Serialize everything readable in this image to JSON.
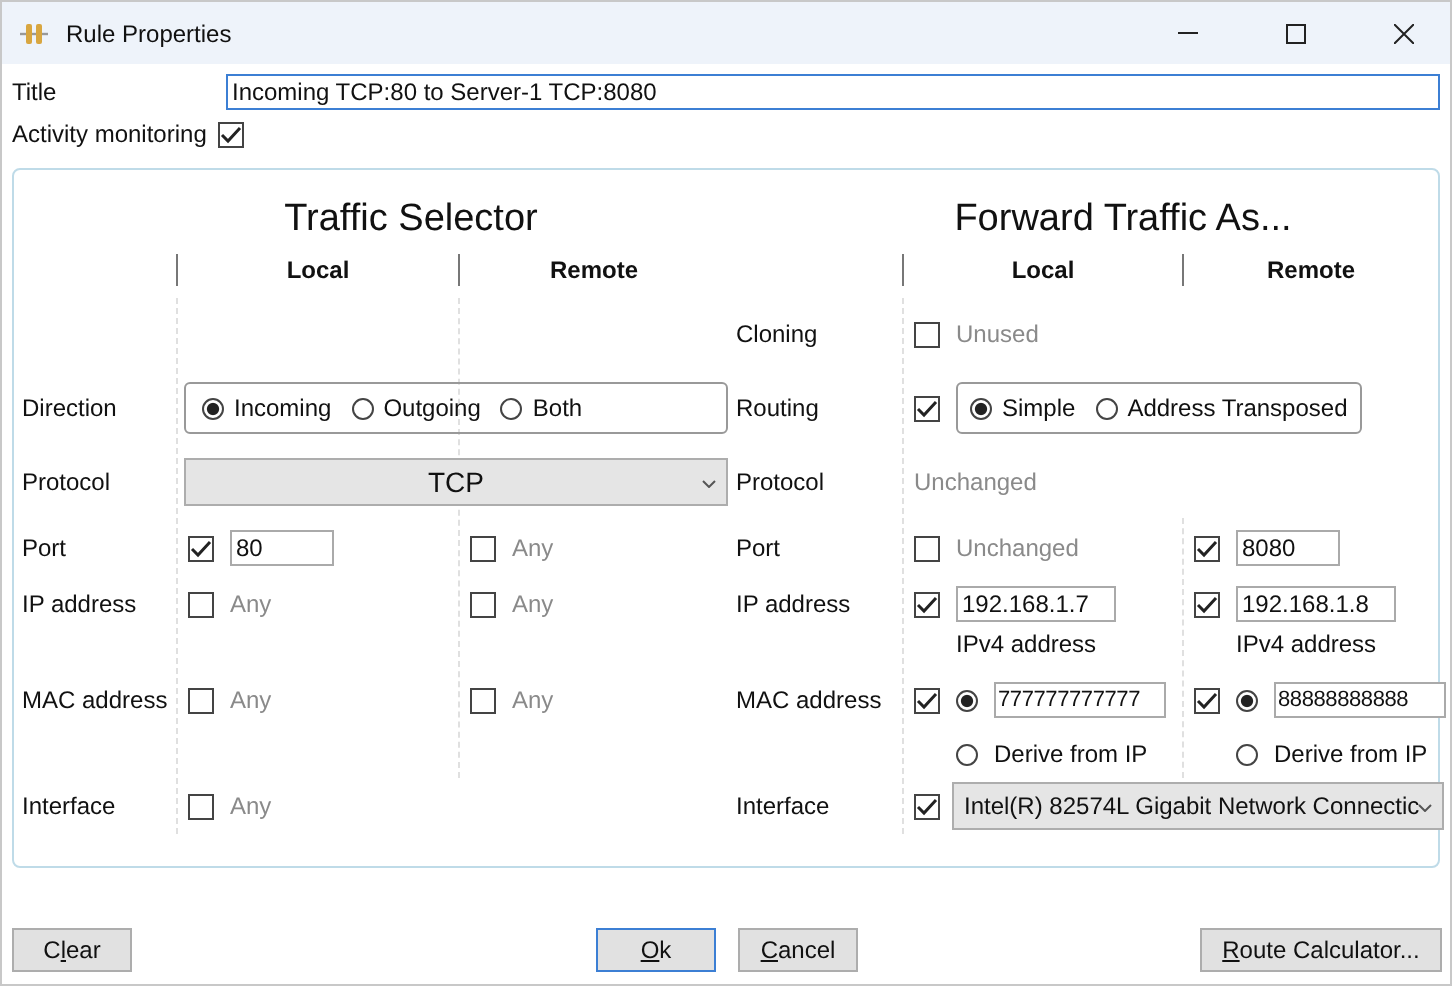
{
  "window": {
    "title": "Rule Properties"
  },
  "title_field": {
    "label": "Title",
    "value": "Incoming TCP:80 to Server-1 TCP:8080"
  },
  "activity_monitoring": {
    "label": "Activity monitoring",
    "checked": true
  },
  "traffic_selector": {
    "heading": "Traffic Selector",
    "column_headers": [
      "Local",
      "Remote"
    ],
    "direction": {
      "label": "Direction",
      "options": [
        {
          "label": "Incoming",
          "selected": true
        },
        {
          "label": "Outgoing",
          "selected": false
        },
        {
          "label": "Both",
          "selected": false
        }
      ]
    },
    "protocol": {
      "label": "Protocol",
      "value": "TCP"
    },
    "port": {
      "label": "Port",
      "local": {
        "checked": true,
        "value": "80"
      },
      "remote": {
        "checked": false,
        "text": "Any"
      }
    },
    "ip_address": {
      "label": "IP address",
      "local": {
        "checked": false,
        "text": "Any"
      },
      "remote": {
        "checked": false,
        "text": "Any"
      }
    },
    "mac_address": {
      "label": "MAC address",
      "local": {
        "checked": false,
        "text": "Any"
      },
      "remote": {
        "checked": false,
        "text": "Any"
      }
    },
    "interface": {
      "label": "Interface",
      "local": {
        "checked": false,
        "text": "Any"
      }
    }
  },
  "forward_traffic": {
    "heading": "Forward Traffic As...",
    "column_headers": [
      "Local",
      "Remote"
    ],
    "cloning": {
      "label": "Cloning",
      "local": {
        "checked": false,
        "text": "Unused"
      }
    },
    "routing": {
      "label": "Routing",
      "checked": true,
      "options": [
        {
          "label": "Simple",
          "selected": true
        },
        {
          "label": "Address Transposed",
          "selected": false
        }
      ]
    },
    "protocol": {
      "label": "Protocol",
      "text": "Unchanged"
    },
    "port": {
      "label": "Port",
      "local": {
        "checked": false,
        "text": "Unchanged"
      },
      "remote": {
        "checked": true,
        "value": "8080"
      }
    },
    "ip_address": {
      "label": "IP address",
      "local": {
        "checked": true,
        "value": "192.168.1.7",
        "hint": "IPv4 address"
      },
      "remote": {
        "checked": true,
        "value": "192.168.1.8",
        "hint": "IPv4 address"
      }
    },
    "mac_address": {
      "label": "MAC address",
      "local": {
        "checked": true,
        "options": [
          {
            "kind": "field",
            "value": "777777777777",
            "selected": true
          },
          {
            "kind": "label",
            "label": "Derive from IP",
            "selected": false
          }
        ]
      },
      "remote": {
        "checked": true,
        "options": [
          {
            "kind": "field",
            "value": "88888888888",
            "selected": true
          },
          {
            "kind": "label",
            "label": "Derive from IP",
            "selected": false
          }
        ]
      }
    },
    "interface": {
      "label": "Interface",
      "checked": true,
      "value": "Intel(R) 82574L Gigabit Network Connectic"
    }
  },
  "buttons": [
    {
      "before": "C",
      "key": "l",
      "after": "ear",
      "default": false,
      "kind": "left"
    },
    {
      "key": "O",
      "after": "k",
      "default": true,
      "kind": "center"
    },
    {
      "key": "C",
      "after": "ancel",
      "default": false,
      "kind": "center"
    },
    {
      "key": "R",
      "after": "oute Calculator...",
      "default": false,
      "kind": "right"
    }
  ]
}
